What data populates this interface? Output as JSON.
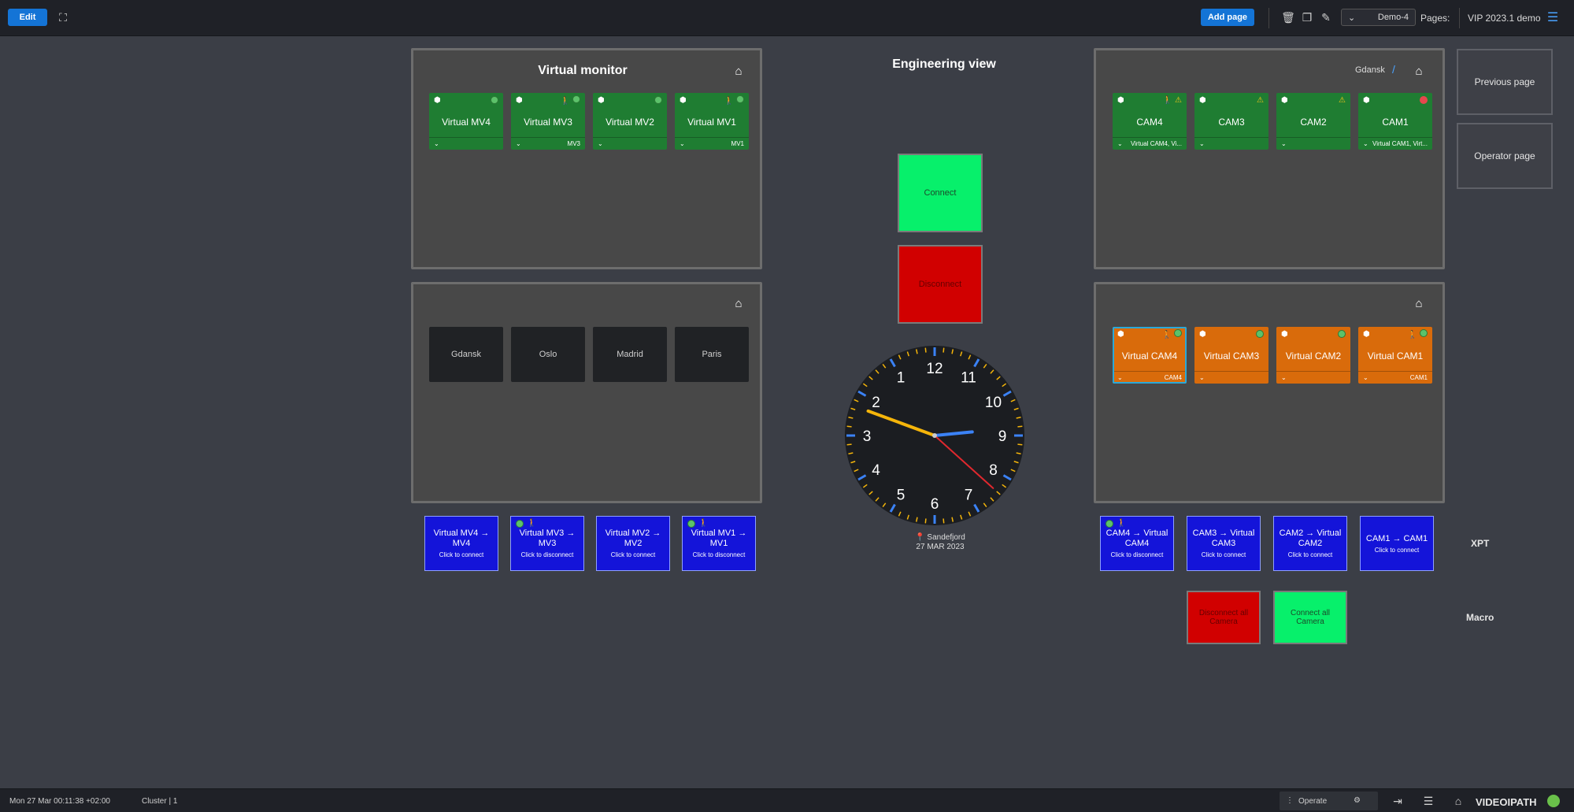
{
  "topbar": {
    "edit_label": "Edit",
    "add_page_label": "Add page",
    "pages_label": "Pages:",
    "current_page": "Demo-4",
    "app_title": "VIP 2023.1 demo",
    "icons": [
      "fullscreen-icon",
      "trash-icon",
      "copy-icon",
      "pencil-icon",
      "menu-icon"
    ]
  },
  "side": {
    "previous_page": "Previous page",
    "operator_page": "Operator page"
  },
  "title": "Engineering view",
  "panels": {
    "cameras_top": {
      "breadcrumb": "Gdansk",
      "tiles": [
        {
          "name": "CAM1",
          "sub": "Virtual CAM1, Virt...",
          "status": "err"
        },
        {
          "name": "CAM2",
          "sub": "",
          "status": "warn"
        },
        {
          "name": "CAM3",
          "sub": "",
          "status": "warn"
        },
        {
          "name": "CAM4",
          "sub": "Virtual CAM4, Vi...",
          "status": "warn"
        }
      ]
    },
    "virtual_monitor": {
      "title": "Virtual monitor",
      "tiles": [
        {
          "name": "Virtual MV1",
          "sub": "MV1"
        },
        {
          "name": "Virtual MV2",
          "sub": ""
        },
        {
          "name": "Virtual MV3",
          "sub": "MV3"
        },
        {
          "name": "Virtual MV4",
          "sub": ""
        }
      ]
    },
    "virtual_cams": {
      "tiles": [
        {
          "name": "Virtual CAM1",
          "sub": "CAM1"
        },
        {
          "name": "Virtual CAM2",
          "sub": ""
        },
        {
          "name": "Virtual CAM3",
          "sub": ""
        },
        {
          "name": "Virtual CAM4",
          "sub": "CAM4"
        }
      ]
    },
    "locations": {
      "cities": [
        "Paris",
        "Madrid",
        "Oslo",
        "Gdansk"
      ]
    }
  },
  "center": {
    "connect_label": "Connect",
    "disconnect_label": "Disconnect",
    "clock": {
      "numbers": [
        "12",
        "1",
        "2",
        "3",
        "4",
        "5",
        "6",
        "7",
        "8",
        "9",
        "10",
        "11"
      ],
      "hour": 9,
      "minute": 11,
      "second": 38,
      "location": "Sandefjord",
      "date": "27 MAR 2023"
    }
  },
  "xpt": {
    "label": "XPT",
    "cams": [
      {
        "l1": "CAM1 → CAM1",
        "l2": "Click to connect",
        "status": false
      },
      {
        "l1": "CAM2 → Virtual CAM2",
        "l2": "Click to connect",
        "status": false
      },
      {
        "l1": "CAM3 → Virtual CAM3",
        "l2": "Click to connect",
        "status": false
      },
      {
        "l1": "CAM4 → Virtual CAM4",
        "l2": "Click to disconnect",
        "status": true
      }
    ],
    "mvs": [
      {
        "l1": "Virtual MV1 → MV1",
        "l2": "Click to disconnect",
        "status": true
      },
      {
        "l1": "Virtual MV2 → MV2",
        "l2": "Click to connect",
        "status": false
      },
      {
        "l1": "Virtual MV3 → MV3",
        "l2": "Click to disconnect",
        "status": true
      },
      {
        "l1": "Virtual MV4 → MV4",
        "l2": "Click to connect",
        "status": false
      }
    ]
  },
  "macro": {
    "label": "Macro",
    "connect_all": "Connect all Camera",
    "disconnect_all": "Disconnect all Camera"
  },
  "bottombar": {
    "brand": "VIDEOIPATH",
    "mode": "Operate",
    "datetime": "Mon 27 Mar  00:11:38 +02:00",
    "cluster": "Cluster | 1"
  },
  "colors": {
    "background": "#3b3e46",
    "tile_green": "#1f7d32",
    "tile_orange": "#d96b0b",
    "xpt_blue": "#1414d9",
    "connect_green": "#07f06b",
    "disconnect_red": "#d10000",
    "accent_blue": "#1474d6"
  }
}
